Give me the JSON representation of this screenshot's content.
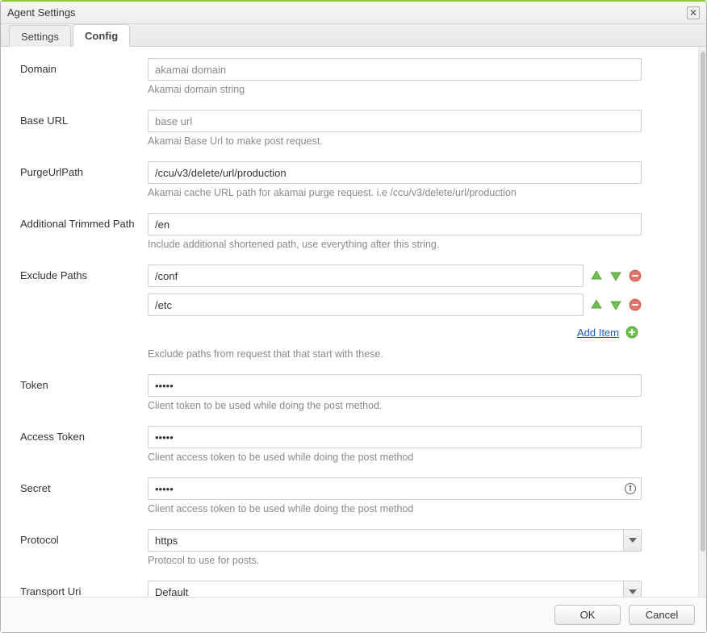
{
  "window": {
    "title": "Agent Settings"
  },
  "tabs": {
    "settings": "Settings",
    "config": "Config",
    "active": "config"
  },
  "fields": {
    "domain": {
      "label": "Domain",
      "placeholder": "akamai domain",
      "value": "",
      "help": "Akamai domain string"
    },
    "base_url": {
      "label": "Base URL",
      "placeholder": "base url",
      "value": "",
      "help": "Akamai Base Url to make post request."
    },
    "purge_url_path": {
      "label": "PurgeUrlPath",
      "value": "/ccu/v3/delete/url/production",
      "help": "Akamai cache URL path for akamai purge request. i.e /ccu/v3/delete/url/production"
    },
    "additional_trimmed_path": {
      "label": "Additional Trimmed Path",
      "value": "/en",
      "help": "Include additional shortened path, use everything after this string."
    },
    "exclude_paths": {
      "label": "Exclude Paths",
      "items": [
        "/conf",
        "/etc"
      ],
      "add_label": "Add Item",
      "help": "Exclude paths from request that that start with these."
    },
    "token": {
      "label": "Token",
      "value": "•••••",
      "help": "Client token to be used while doing the post method."
    },
    "access_token": {
      "label": "Access Token",
      "value": "•••••",
      "help": "Client access token to be used while doing the post method"
    },
    "secret": {
      "label": "Secret",
      "value": "•••••",
      "help": "Client access token to be used while doing the post method"
    },
    "protocol": {
      "label": "Protocol",
      "value": "https",
      "help": "Protocol to use for posts."
    },
    "transport_uri": {
      "label": "Transport Uri",
      "value": "Default"
    }
  },
  "buttons": {
    "ok": "OK",
    "cancel": "Cancel"
  }
}
